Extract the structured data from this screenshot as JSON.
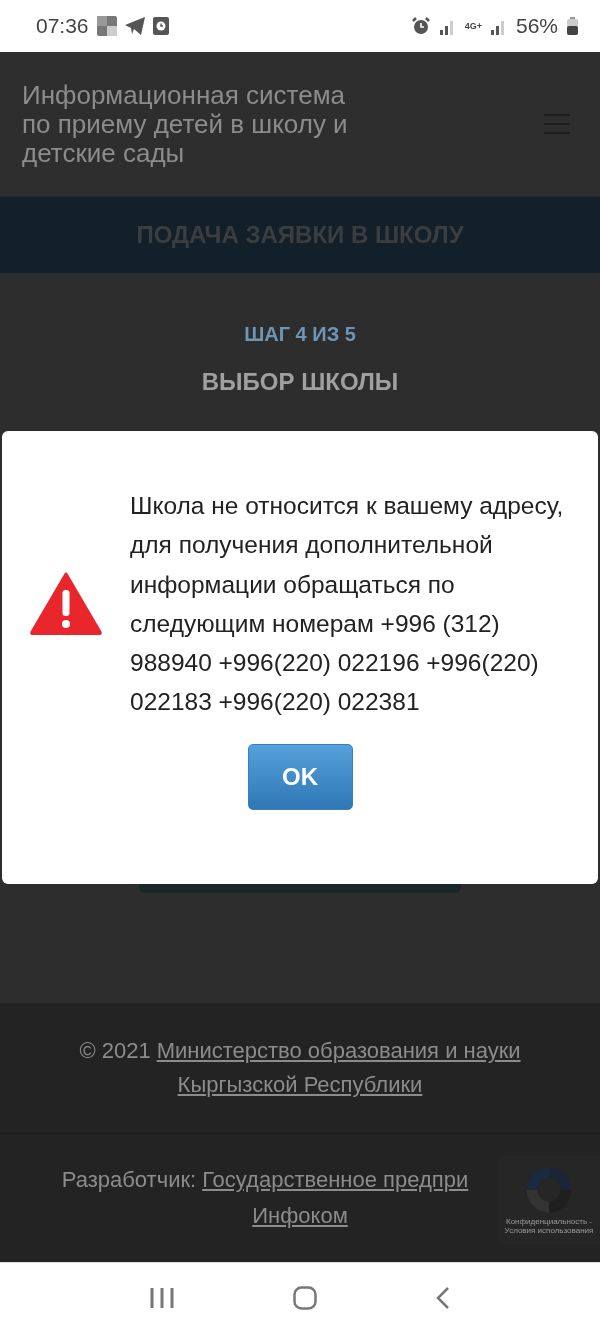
{
  "status_bar": {
    "time": "07:36",
    "network": "4G+",
    "battery": "56%"
  },
  "header": {
    "title_lines": [
      "Информационная система",
      "по приему детей в школу и",
      "детские сады"
    ]
  },
  "banner": {
    "title": "ПОДАЧА ЗАЯВКИ В ШКОЛУ"
  },
  "step": {
    "label": "ШАГ 4 ИЗ 5",
    "title": "ВЫБОР ШКОЛЫ"
  },
  "dialog": {
    "message": "Школа не относится к вашему адресу, для получения дополнительной информации обращаться по следующим номерам +996 (312) 988940 +996(220) 022196 +996(220) 022183 +996(220) 022381",
    "button": "OK"
  },
  "footer": {
    "copyright": {
      "text": "© 2021",
      "link_lines": [
        "Министерство образования и науки",
        "Кыргызской Республики"
      ]
    },
    "developer": {
      "label": "Разработчик:",
      "link_lines": [
        "Государственное предпри",
        "Инфоком"
      ]
    }
  },
  "recaptcha": {
    "text": "Конфиденциальность - Условия использования"
  }
}
